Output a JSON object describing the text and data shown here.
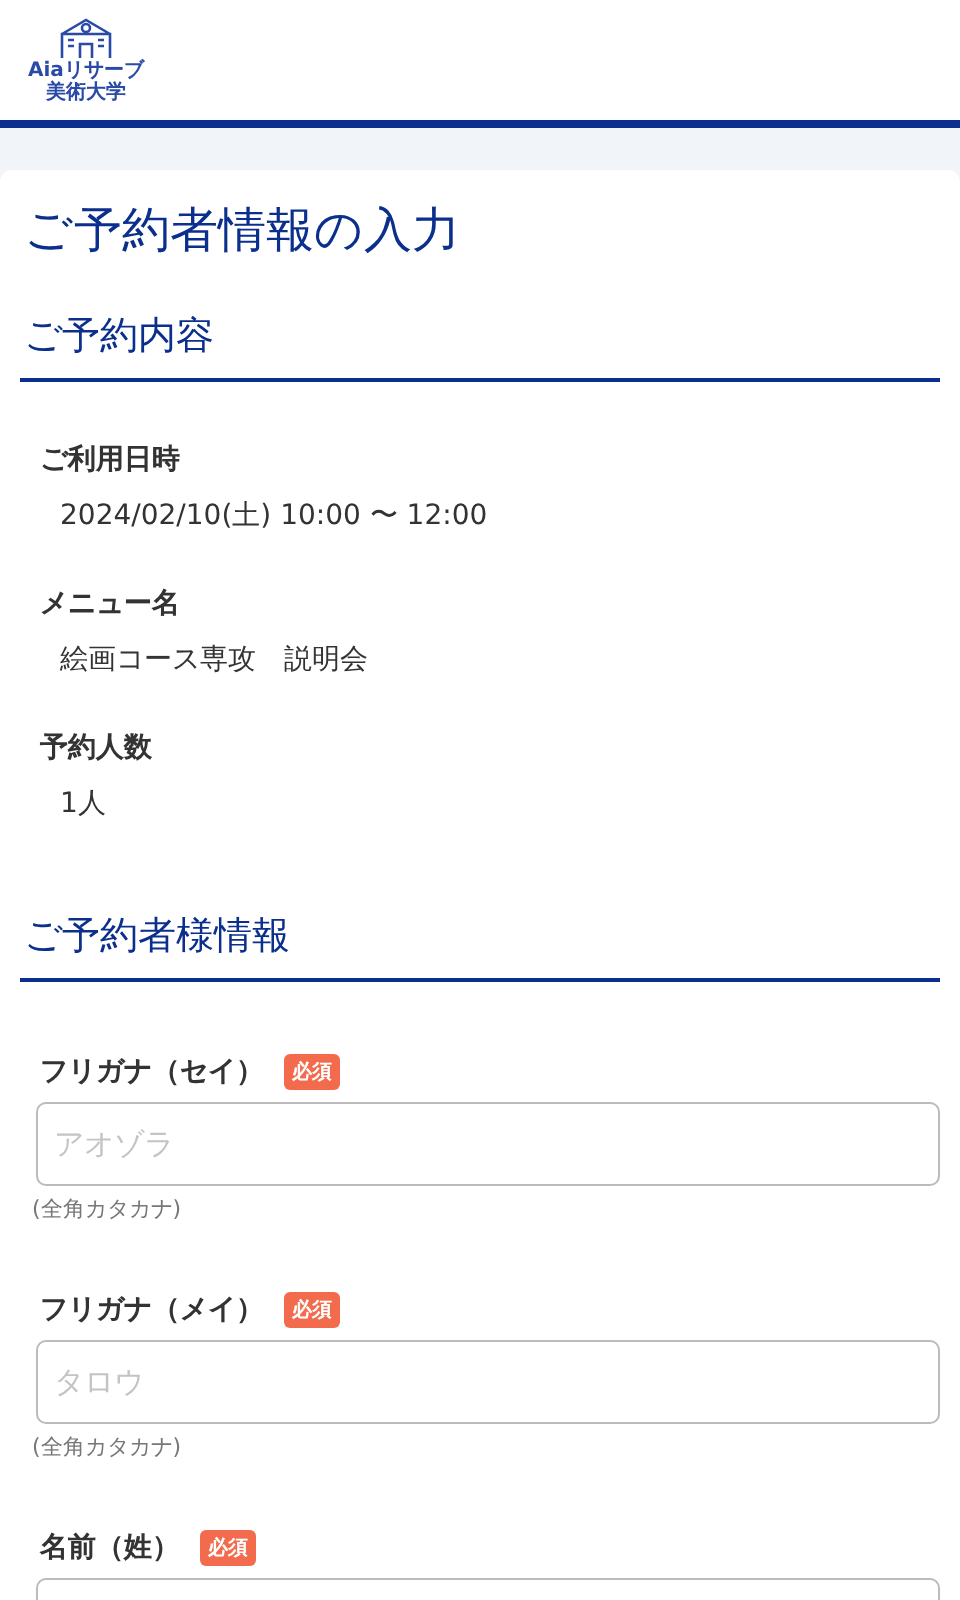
{
  "logo": {
    "line_1": "Aiaリサーブ",
    "line_2": "美術大学"
  },
  "page_title": "ご予約者情報の入力",
  "reservation": {
    "heading": "ご予約内容",
    "items": [
      {
        "label": "ご利用日時",
        "value": "2024/02/10(土) 10:00 〜 12:00"
      },
      {
        "label": "メニュー名",
        "value": "絵画コース専攻　説明会"
      },
      {
        "label": "予約人数",
        "value": "1人"
      }
    ]
  },
  "customer": {
    "heading": "ご予約者様情報",
    "fields": [
      {
        "label": "フリガナ（セイ）",
        "required": true,
        "required_badge": "必須",
        "placeholder": "アオゾラ",
        "note": "(全角カタカナ)"
      },
      {
        "label": "フリガナ（メイ）",
        "required": true,
        "required_badge": "必須",
        "placeholder": "タロウ",
        "note": "(全角カタカナ)"
      },
      {
        "label": "名前（姓）",
        "required": true,
        "required_badge": "必須"
      }
    ]
  }
}
